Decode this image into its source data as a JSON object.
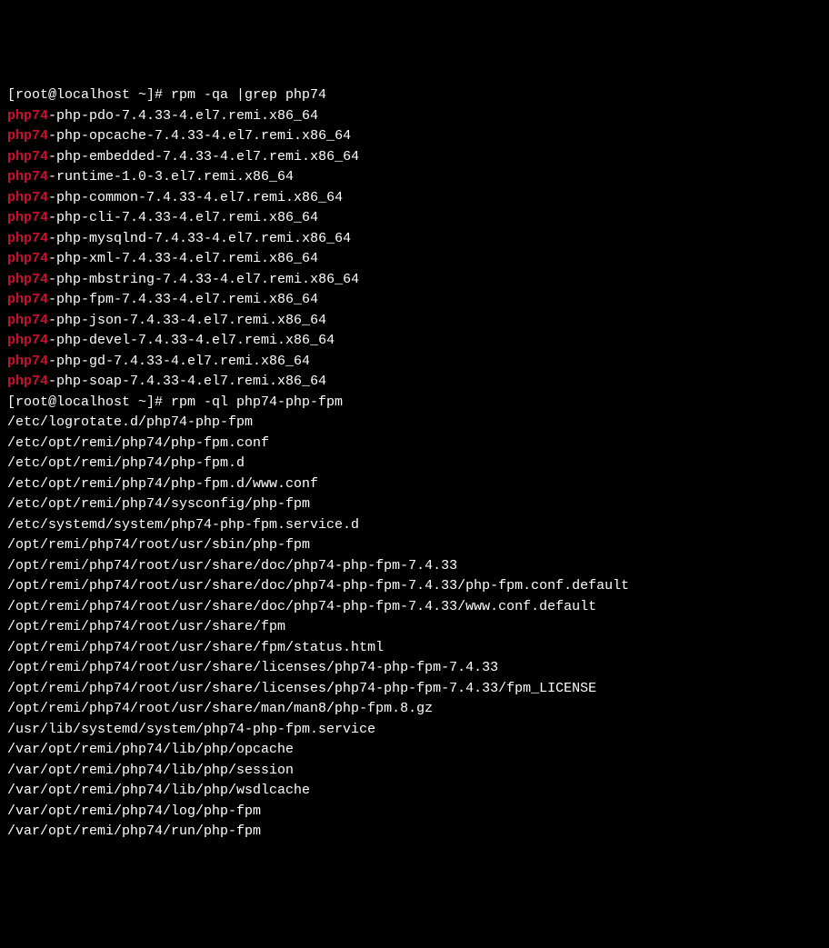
{
  "prompt1": "[root@localhost ~]# rpm -qa |grep php74",
  "packages": [
    {
      "hl": "php74",
      "rest": "-php-pdo-7.4.33-4.el7.remi.x86_64"
    },
    {
      "hl": "php74",
      "rest": "-php-opcache-7.4.33-4.el7.remi.x86_64"
    },
    {
      "hl": "php74",
      "rest": "-php-embedded-7.4.33-4.el7.remi.x86_64"
    },
    {
      "hl": "php74",
      "rest": "-runtime-1.0-3.el7.remi.x86_64"
    },
    {
      "hl": "php74",
      "rest": "-php-common-7.4.33-4.el7.remi.x86_64"
    },
    {
      "hl": "php74",
      "rest": "-php-cli-7.4.33-4.el7.remi.x86_64"
    },
    {
      "hl": "php74",
      "rest": "-php-mysqlnd-7.4.33-4.el7.remi.x86_64"
    },
    {
      "hl": "php74",
      "rest": "-php-xml-7.4.33-4.el7.remi.x86_64"
    },
    {
      "hl": "php74",
      "rest": "-php-mbstring-7.4.33-4.el7.remi.x86_64"
    },
    {
      "hl": "php74",
      "rest": "-php-fpm-7.4.33-4.el7.remi.x86_64"
    },
    {
      "hl": "php74",
      "rest": "-php-json-7.4.33-4.el7.remi.x86_64"
    },
    {
      "hl": "php74",
      "rest": "-php-devel-7.4.33-4.el7.remi.x86_64"
    },
    {
      "hl": "php74",
      "rest": "-php-gd-7.4.33-4.el7.remi.x86_64"
    },
    {
      "hl": "php74",
      "rest": "-php-soap-7.4.33-4.el7.remi.x86_64"
    }
  ],
  "prompt2": "[root@localhost ~]# rpm -ql php74-php-fpm",
  "files": [
    "/etc/logrotate.d/php74-php-fpm",
    "/etc/opt/remi/php74/php-fpm.conf",
    "/etc/opt/remi/php74/php-fpm.d",
    "/etc/opt/remi/php74/php-fpm.d/www.conf",
    "/etc/opt/remi/php74/sysconfig/php-fpm",
    "/etc/systemd/system/php74-php-fpm.service.d",
    "/opt/remi/php74/root/usr/sbin/php-fpm",
    "/opt/remi/php74/root/usr/share/doc/php74-php-fpm-7.4.33",
    "/opt/remi/php74/root/usr/share/doc/php74-php-fpm-7.4.33/php-fpm.conf.default",
    "/opt/remi/php74/root/usr/share/doc/php74-php-fpm-7.4.33/www.conf.default",
    "/opt/remi/php74/root/usr/share/fpm",
    "/opt/remi/php74/root/usr/share/fpm/status.html",
    "/opt/remi/php74/root/usr/share/licenses/php74-php-fpm-7.4.33",
    "/opt/remi/php74/root/usr/share/licenses/php74-php-fpm-7.4.33/fpm_LICENSE",
    "/opt/remi/php74/root/usr/share/man/man8/php-fpm.8.gz",
    "/usr/lib/systemd/system/php74-php-fpm.service",
    "/var/opt/remi/php74/lib/php/opcache",
    "/var/opt/remi/php74/lib/php/session",
    "/var/opt/remi/php74/lib/php/wsdlcache",
    "/var/opt/remi/php74/log/php-fpm",
    "/var/opt/remi/php74/run/php-fpm"
  ]
}
